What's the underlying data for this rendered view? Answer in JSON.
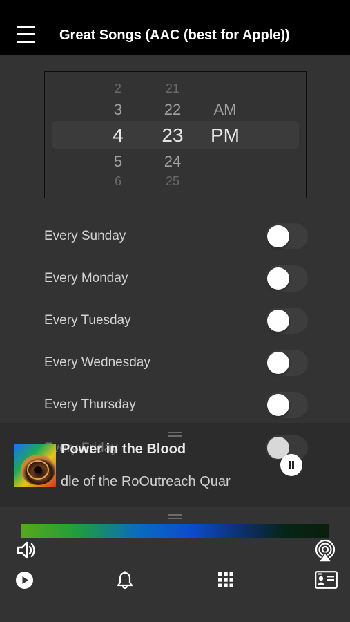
{
  "header": {
    "menu_icon": "hamburger-menu-icon",
    "title": "Great Songs (AAC (best for Apple))"
  },
  "time_picker": {
    "hours": [
      "2",
      "3",
      "4",
      "5",
      "6"
    ],
    "minutes": [
      "21",
      "22",
      "23",
      "24",
      "25"
    ],
    "ampm": [
      "AM",
      "PM"
    ],
    "selected_hour": "4",
    "selected_minute": "23",
    "selected_ampm": "PM"
  },
  "days": [
    {
      "label": "Every Sunday",
      "on": false
    },
    {
      "label": "Every Monday",
      "on": false
    },
    {
      "label": "Every Tuesday",
      "on": false
    },
    {
      "label": "Every Wednesday",
      "on": false
    },
    {
      "label": "Every Thursday",
      "on": false
    },
    {
      "label": "Every Friday",
      "on": false
    }
  ],
  "now_playing": {
    "title": "Power in the Blood",
    "subtitle": "dle of the RoOutreach Quar",
    "pause_icon": "pause-icon"
  },
  "bottom": {
    "volume_icon": "speaker-icon",
    "airplay_icon": "airplay-icon",
    "play_icon": "play-icon",
    "alarm_icon": "bell-icon",
    "grid_icon": "grid-icon",
    "contact_icon": "contact-card-icon"
  },
  "colors": {
    "top_bar": "#000000",
    "background": "#333333",
    "toggle_off": "#3d3d3d",
    "knob": "#ffffff"
  }
}
